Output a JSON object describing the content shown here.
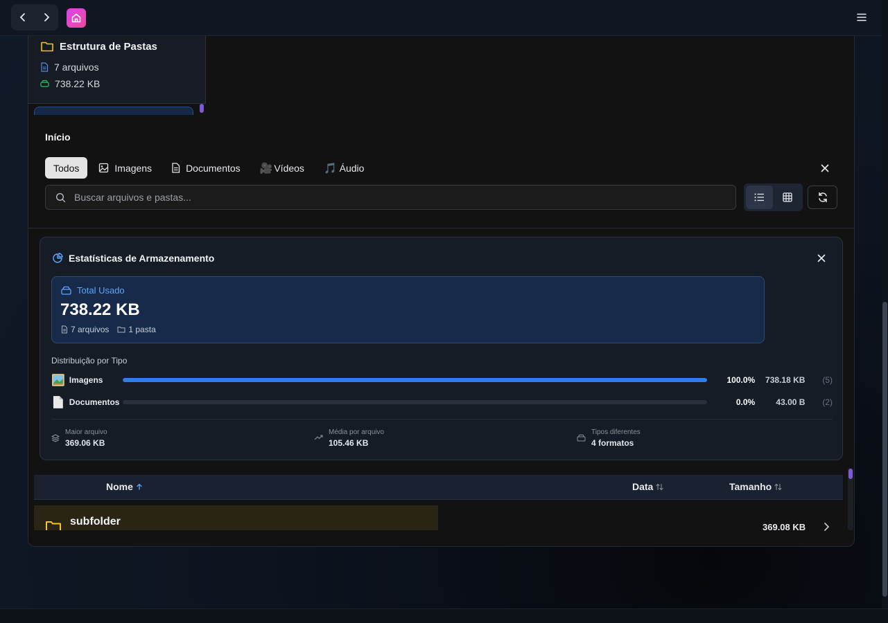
{
  "topbar": {
    "back_icon": "chevron-left-icon",
    "forward_icon": "chevron-right-icon",
    "home_icon": "home-icon",
    "menu_icon": "hamburger-icon"
  },
  "folder_card": {
    "title": "Estrutura de Pastas",
    "files": "7 arquivos",
    "size": "738.22 KB"
  },
  "breadcrumb": "Início",
  "tabs": [
    {
      "label": "Todos",
      "active": true
    },
    {
      "label": "Imagens",
      "icon": "image-icon"
    },
    {
      "label": "Documentos",
      "icon": "document-icon"
    },
    {
      "label": "Vídeos",
      "icon": "film-camera-emoji"
    },
    {
      "label": "Áudio",
      "icon": "music-note-emoji"
    }
  ],
  "search": {
    "placeholder": "Buscar arquivos e pastas..."
  },
  "stats": {
    "title": "Estatísticas de Armazenamento",
    "total_label": "Total Usado",
    "total_value": "738.22 KB",
    "files": "7 arquivos",
    "folders": "1 pasta",
    "dist_title": "Distribuição por Tipo",
    "rows": [
      {
        "name": "Imagens",
        "percent": "100.0%",
        "fraction": 1.0,
        "size": "738.18 KB",
        "count": "(5)"
      },
      {
        "name": "Documentos",
        "percent": "0.0%",
        "fraction": 0.0,
        "size": "43.00 B",
        "count": "(2)"
      }
    ],
    "metrics": [
      {
        "label": "Maior arquivo",
        "value": "369.06 KB",
        "icon": "layers-icon"
      },
      {
        "label": "Média por arquivo",
        "value": "105.46 KB",
        "icon": "trend-up-icon"
      },
      {
        "label": "Tipos diferentes",
        "value": "4 formatos",
        "icon": "drive-icon"
      }
    ]
  },
  "table": {
    "col_name": "Nome",
    "col_date": "Data",
    "col_size": "Tamanho",
    "rows": [
      {
        "name": "subfolder",
        "size": "369.08 KB"
      }
    ]
  },
  "colors": {
    "accent": "#2d7ff0",
    "brand_gradient_start": "#d946ef",
    "folder_yellow": "#f5c518"
  }
}
